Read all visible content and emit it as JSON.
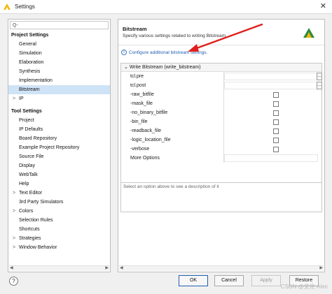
{
  "window": {
    "title": "Settings",
    "close_glyph": "✕"
  },
  "search": {
    "icon": "search-icon",
    "glyph": "Q-"
  },
  "project_settings": {
    "heading": "Project Settings",
    "items": [
      {
        "label": "General"
      },
      {
        "label": "Simulation"
      },
      {
        "label": "Elaboration"
      },
      {
        "label": "Synthesis"
      },
      {
        "label": "Implementation"
      },
      {
        "label": "Bitstream",
        "selected": true
      },
      {
        "label": "IP",
        "expandable": true
      }
    ]
  },
  "tool_settings": {
    "heading": "Tool Settings",
    "items": [
      {
        "label": "Project"
      },
      {
        "label": "IP Defaults"
      },
      {
        "label": "Board Repository"
      },
      {
        "label": "Example Project Repository"
      },
      {
        "label": "Source File"
      },
      {
        "label": "Display"
      },
      {
        "label": "WebTalk"
      },
      {
        "label": "Help"
      },
      {
        "label": "Text Editor",
        "expandable": true
      },
      {
        "label": "3rd Party Simulators"
      },
      {
        "label": "Colors",
        "expandable": true
      },
      {
        "label": "Selection Rules"
      },
      {
        "label": "Shortcuts"
      },
      {
        "label": "Strategies",
        "expandable": true
      },
      {
        "label": "Window Behavior",
        "expandable": true
      }
    ]
  },
  "section": {
    "title": "Bitstream",
    "description": "Specify various settings related to writing Bitstream",
    "info_link": "Configure additional bitstream settings."
  },
  "grid": {
    "header": "Write Bitstream (write_bitstream)",
    "rows": [
      {
        "label": "tcl.pre",
        "kind": "file"
      },
      {
        "label": "tcl.post",
        "kind": "file"
      },
      {
        "label": "-raw_bitfile",
        "kind": "checkbox",
        "checked": false
      },
      {
        "label": "-mask_file",
        "kind": "checkbox",
        "checked": false
      },
      {
        "label": "-no_binary_bitfile",
        "kind": "checkbox",
        "checked": false
      },
      {
        "label": "-bin_file",
        "kind": "checkbox",
        "checked": false
      },
      {
        "label": "-readback_file",
        "kind": "checkbox",
        "checked": false
      },
      {
        "label": "-logic_location_file",
        "kind": "checkbox",
        "checked": false
      },
      {
        "label": "-verbose",
        "kind": "checkbox",
        "checked": false
      },
      {
        "label": "More Options",
        "kind": "text"
      }
    ]
  },
  "description_box": {
    "placeholder": "Select an option above to see a description of it"
  },
  "footer": {
    "help_glyph": "?",
    "ok": "OK",
    "cancel": "Cancel",
    "apply": "Apply",
    "restore": "Restore"
  },
  "watermark": "CSDN @文伦 Alen",
  "colors": {
    "selection": "#cfe3f7",
    "link": "#1f5fb2",
    "annotation_arrow": "#e0201c"
  }
}
